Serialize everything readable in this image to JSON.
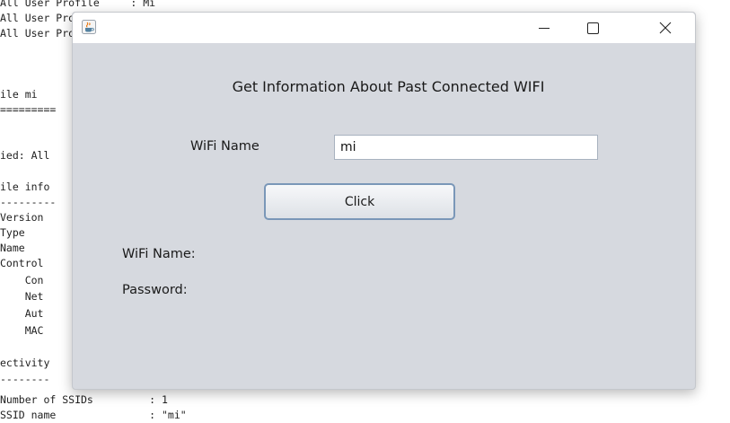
{
  "terminal": {
    "lines": [
      "All User Profile     : Mi   ",
      "All User Profile",
      "All User Profile",
      "",
      "",
      "ile mi",
      "=========",
      "",
      "ied: All",
      "",
      "ile info",
      "---------",
      "Version",
      "Type",
      "Name",
      "Control",
      "    Con",
      "    Net",
      "    Aut",
      "    MAC",
      "",
      "ectivity",
      "--------",
      "Number of SSIDs         : 1",
      "SSID name               : \"mi\""
    ]
  },
  "window": {
    "title": "",
    "heading": "Get  Information About Past Connected WIFI",
    "wifi_name_label": "WiFi Name",
    "wifi_name_value": "mi",
    "click_button_label": "Click",
    "result_wifi_label": "WiFi Name:",
    "result_password_label": "Password:"
  },
  "icons": {
    "app_icon": "java-coffee-cup-icon",
    "minimize": "minimize-icon",
    "maximize": "maximize-icon",
    "close": "close-icon"
  }
}
